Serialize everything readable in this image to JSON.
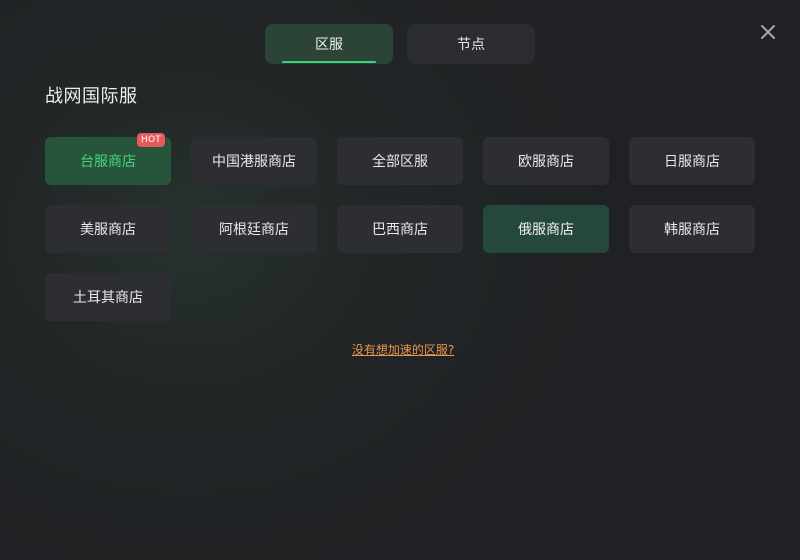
{
  "tabs": [
    {
      "label": "区服",
      "active": true
    },
    {
      "label": "节点",
      "active": false
    }
  ],
  "section": {
    "title": "战网国际服"
  },
  "regions": [
    {
      "label": "台服商店",
      "badge": "HOT"
    },
    {
      "label": "中国港服商店"
    },
    {
      "label": "全部区服"
    },
    {
      "label": "欧服商店"
    },
    {
      "label": "日服商店"
    },
    {
      "label": "美服商店"
    },
    {
      "label": "阿根廷商店"
    },
    {
      "label": "巴西商店"
    },
    {
      "label": "俄服商店",
      "selected": true
    },
    {
      "label": "韩服商店"
    },
    {
      "label": "土耳其商店"
    }
  ],
  "help_link": "没有想加速的区服?",
  "icons": {
    "close": "close-icon"
  },
  "colors": {
    "accent_green": "#3ecf7d",
    "hot_text_green": "#46d483",
    "hot_badge_red": "#e55a5a",
    "link_orange": "#e8944a",
    "background": "#202124"
  }
}
